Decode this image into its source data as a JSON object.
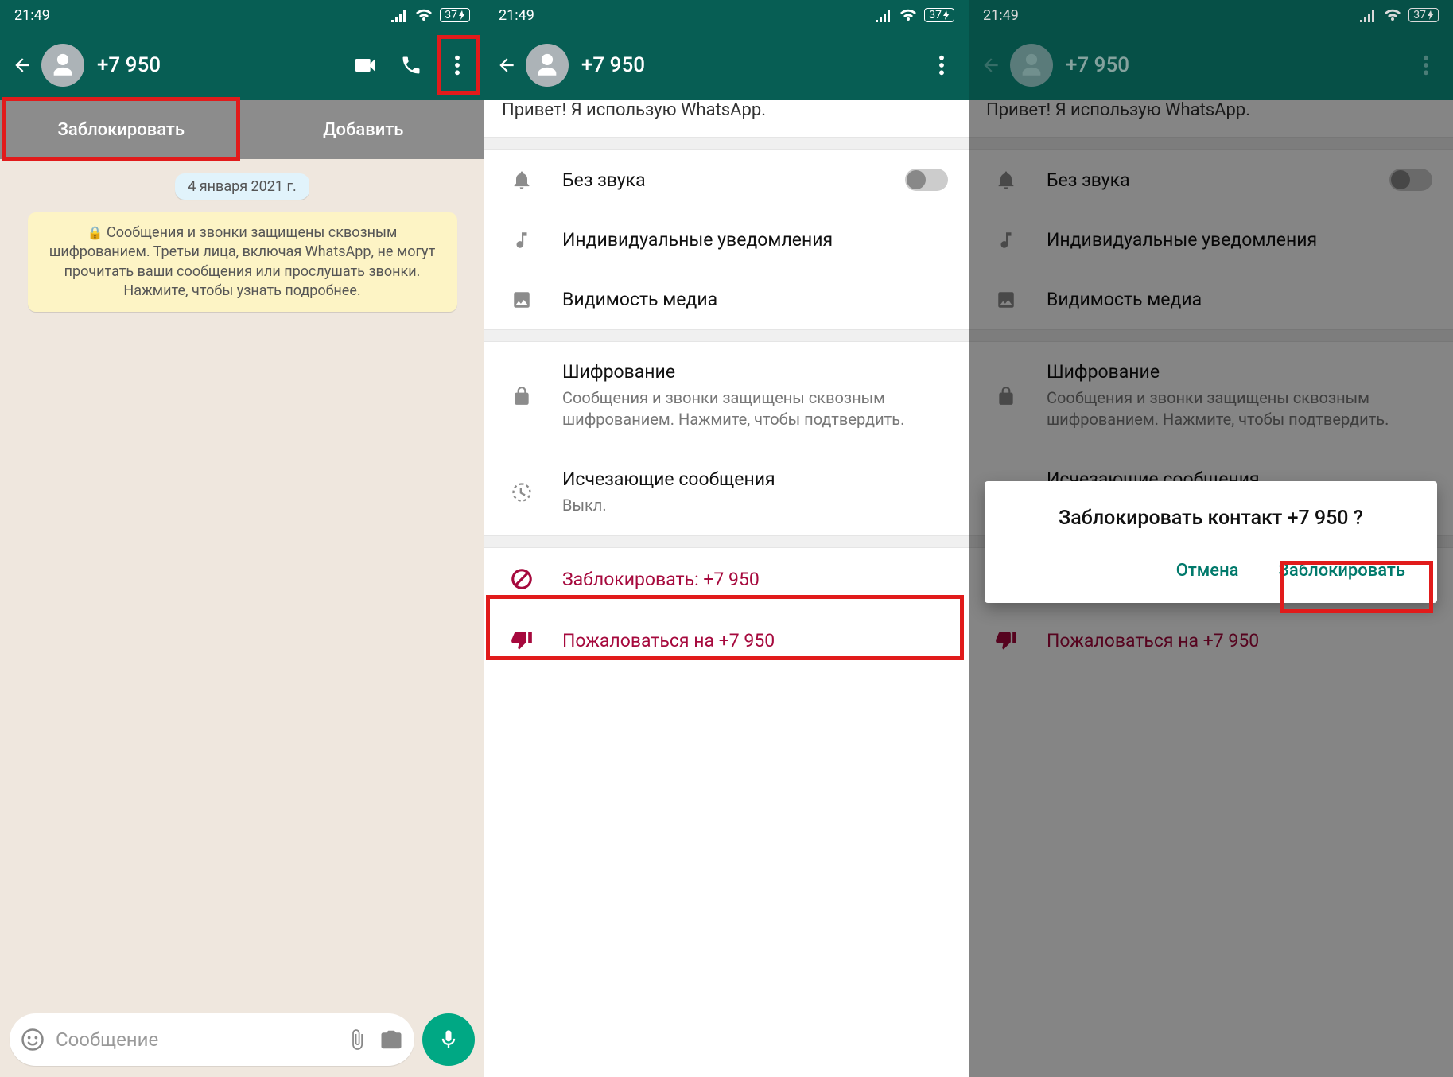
{
  "status": {
    "time": "21:49",
    "battery": "37"
  },
  "contact": {
    "name": "+7 950"
  },
  "screen1": {
    "tabs": {
      "block": "Заблокировать",
      "add": "Добавить"
    },
    "date": "4 января 2021 г.",
    "encryption_notice": "Сообщения и звонки защищены сквозным шифрованием. Третьи лица, включая WhatsApp, не могут прочитать ваши сообщения или прослушать звонки. Нажмите, чтобы узнать подробнее.",
    "input_placeholder": "Сообщение"
  },
  "info": {
    "peek": "Привет! Я использую WhatsApp.",
    "mute": "Без звука",
    "custom_notifications": "Индивидуальные уведомления",
    "media_visibility": "Видимость медиа",
    "encryption_title": "Шифрование",
    "encryption_sub": "Сообщения и звонки защищены сквозным шифрованием. Нажмите, чтобы подтвердить.",
    "disappearing_title": "Исчезающие сообщения",
    "disappearing_sub": "Выкл.",
    "block_label": "Заблокировать: +7 950",
    "report_label": "Пожаловаться на +7 950"
  },
  "dialog": {
    "title": "Заблокировать контакт +7 950 ?",
    "cancel": "Отмена",
    "confirm": "Заблокировать"
  }
}
